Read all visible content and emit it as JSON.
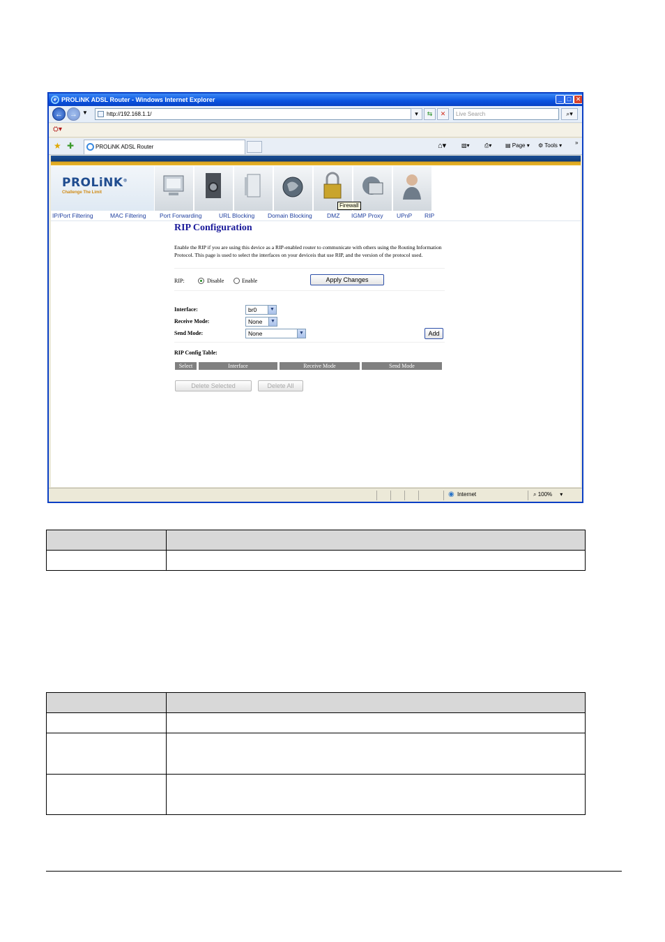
{
  "window": {
    "title": "PROLiNK ADSL Router - Windows Internet Explorer",
    "address": "http://192.168.1.1/",
    "search_placeholder": "Live Search",
    "tab_title": "PROLiNK ADSL Router",
    "cmd_page": "Page",
    "cmd_tools": "Tools",
    "chevron": "»",
    "status_zone": "Internet",
    "zoom": "100%"
  },
  "brand": {
    "logo": "PROLiNK",
    "logo_mark": "®",
    "tagline": "Challenge The Limit",
    "tooltip": "Firewall"
  },
  "menu": [
    "IP/Port Filtering",
    "MAC Filtering",
    "Port Forwarding",
    "URL Blocking",
    "Domain Blocking",
    "DMZ",
    "IGMP Proxy",
    "UPnP",
    "RIP"
  ],
  "rip": {
    "title": "RIP Configuration",
    "description": "Enable the RIP if you are using this device as a RIP-enabled router to communicate with others using the Routing Information Protocol. This page is used to select the interfaces on your deviceis that use RIP, and the version of the protocol used.",
    "rip_label": "RIP:",
    "disable": "Disable",
    "enable": "Enable",
    "apply_button": "Apply Changes",
    "interface_label": "Interface:",
    "interface_value": "br0",
    "receive_label": "Receive Mode:",
    "receive_value": "None",
    "send_label": "Send Mode:",
    "send_value": "None",
    "add_button": "Add",
    "table_label": "RIP Config Table:",
    "columns": [
      "Select",
      "Interface",
      "Receive Mode",
      "Send Mode"
    ],
    "delete_selected": "Delete Selected",
    "delete_all": "Delete All"
  }
}
